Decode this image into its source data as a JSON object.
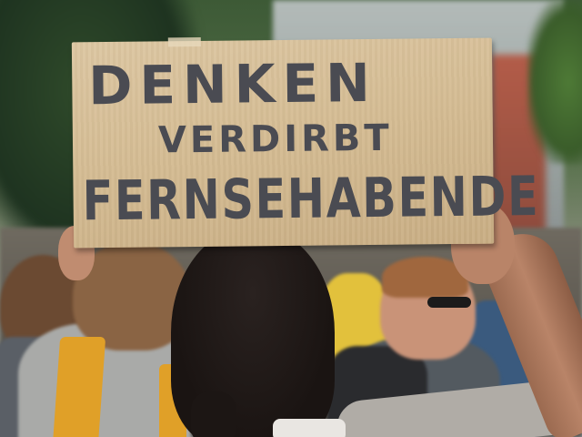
{
  "scene": {
    "description_label": "",
    "sign": {
      "line1": "DENKEN",
      "line2": "VERDIRBT",
      "line3": "FERNSEHABENDE"
    }
  },
  "colors": {
    "cardboard": "#d4bb92",
    "marker": "#4a4b52",
    "strap": "#e0a028",
    "yellow_shirt": "#e2c13c"
  }
}
